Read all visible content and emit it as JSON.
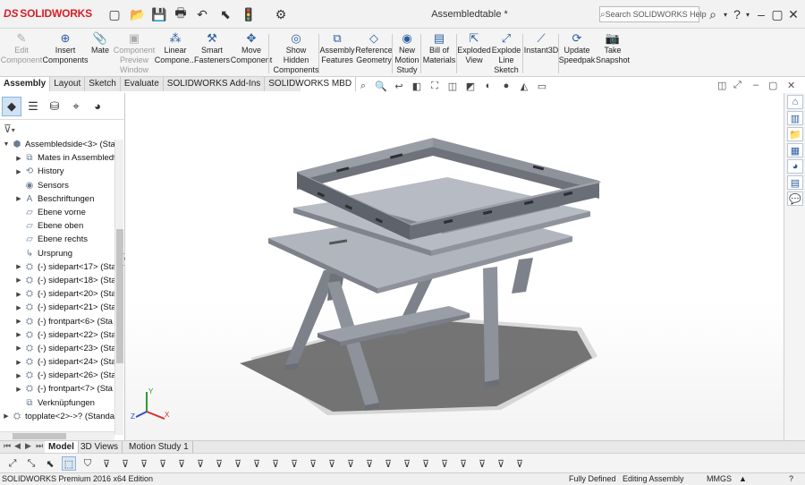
{
  "app": {
    "brand": "SOLIDWORKS",
    "brand_prefix": "DS",
    "document_title": "Assembledtable *"
  },
  "quick_access": [
    {
      "name": "new-document-icon",
      "glyph": "▢"
    },
    {
      "name": "open-document-icon",
      "glyph": "📂"
    },
    {
      "name": "save-icon",
      "glyph": "💾"
    },
    {
      "name": "print-icon",
      "glyph": "🖶"
    },
    {
      "name": "undo-icon",
      "glyph": "↶"
    },
    {
      "name": "select-cursor-icon",
      "glyph": "⬉"
    },
    {
      "name": "rebuild-icon",
      "glyph": "🚦"
    },
    {
      "name": "options-gear-icon",
      "glyph": "⚙"
    }
  ],
  "search": {
    "placeholder": "Search SOLIDWORKS Help",
    "icon": "search-icon"
  },
  "window_controls": {
    "help": "?",
    "minimize": "–",
    "restore": "▢",
    "close": "✕"
  },
  "command_manager": [
    {
      "id": "edit-component",
      "label": "Edit Component",
      "disabled": true,
      "icon": "edit-component-icon",
      "glyph": "✎"
    },
    {
      "id": "insert-components",
      "label": "Insert Components",
      "disabled": false,
      "icon": "insert-components-icon",
      "glyph": "⊕"
    },
    {
      "id": "mate",
      "label": "Mate",
      "disabled": false,
      "icon": "mate-paperclip-icon",
      "glyph": "📎"
    },
    {
      "id": "component-preview-window",
      "label": "Component Preview Window",
      "disabled": true,
      "icon": "component-preview-icon",
      "glyph": "▣"
    },
    {
      "id": "linear-component-pattern",
      "label": "Linear Compone...",
      "disabled": false,
      "icon": "linear-pattern-icon",
      "glyph": "⁂"
    },
    {
      "id": "smart-fasteners",
      "label": "Smart Fasteners",
      "disabled": false,
      "icon": "smart-fasteners-icon",
      "glyph": "⚒"
    },
    {
      "id": "move-component",
      "label": "Move Component",
      "disabled": false,
      "icon": "move-component-icon",
      "glyph": "✥"
    },
    {
      "id": "show-hidden-components",
      "label": "Show Hidden Components",
      "disabled": false,
      "icon": "show-hidden-icon",
      "glyph": "◎"
    },
    {
      "id": "assembly-features",
      "label": "Assembly Features",
      "disabled": false,
      "icon": "assembly-features-icon",
      "glyph": "⧉"
    },
    {
      "id": "reference-geometry",
      "label": "Reference Geometry",
      "disabled": false,
      "icon": "reference-geometry-icon",
      "glyph": "◇"
    },
    {
      "id": "new-motion-study",
      "label": "New Motion Study",
      "disabled": false,
      "icon": "motion-study-icon",
      "glyph": "◉"
    },
    {
      "id": "bill-of-materials",
      "label": "Bill of Materials",
      "disabled": false,
      "icon": "bill-of-materials-icon",
      "glyph": "▤"
    },
    {
      "id": "exploded-view",
      "label": "Exploded View",
      "disabled": false,
      "icon": "exploded-view-icon",
      "glyph": "⇱"
    },
    {
      "id": "explode-line-sketch",
      "label": "Explode Line Sketch",
      "disabled": false,
      "icon": "explode-line-sketch-icon",
      "glyph": "⤢"
    },
    {
      "id": "instant3d",
      "label": "Instant3D",
      "disabled": false,
      "icon": "instant3d-icon",
      "glyph": "⟋"
    },
    {
      "id": "update-speedpak",
      "label": "Update Speedpak",
      "disabled": false,
      "icon": "speedpak-icon",
      "glyph": "⟳"
    },
    {
      "id": "take-snapshot",
      "label": "Take Snapshot",
      "disabled": false,
      "icon": "camera-icon",
      "glyph": "📷"
    }
  ],
  "tabs": [
    {
      "label": "Assembly",
      "active": true
    },
    {
      "label": "Layout",
      "active": false
    },
    {
      "label": "Sketch",
      "active": false
    },
    {
      "label": "Evaluate",
      "active": false
    },
    {
      "label": "SOLIDWORKS Add-Ins",
      "active": false
    },
    {
      "label": "SOLIDWORKS MBD",
      "active": false
    }
  ],
  "heads_up": [
    {
      "name": "zoom-to-fit-icon",
      "glyph": "⌕"
    },
    {
      "name": "zoom-to-area-icon",
      "glyph": "🔍"
    },
    {
      "name": "previous-view-icon",
      "glyph": "↩"
    },
    {
      "name": "section-view-icon",
      "glyph": "◧"
    },
    {
      "name": "dynamic-annotation-icon",
      "glyph": "⛶"
    },
    {
      "name": "view-orientation-icon",
      "glyph": "◫"
    },
    {
      "name": "display-style-icon",
      "glyph": "◩"
    },
    {
      "name": "hide-show-items-icon",
      "glyph": "◐"
    },
    {
      "name": "edit-appearance-icon",
      "glyph": "●"
    },
    {
      "name": "apply-scene-icon",
      "glyph": "◭"
    },
    {
      "name": "view-settings-icon",
      "glyph": "▭"
    }
  ],
  "feature_manager": {
    "tabs": [
      {
        "name": "featuremanager-tab-icon",
        "glyph": "◆",
        "selected": true
      },
      {
        "name": "propertymanager-tab-icon",
        "glyph": "☰",
        "selected": false
      },
      {
        "name": "configurationmanager-tab-icon",
        "glyph": "⛁",
        "selected": false
      },
      {
        "name": "dimxpert-tab-icon",
        "glyph": "⌖",
        "selected": false
      },
      {
        "name": "display-manager-tab-icon",
        "glyph": "◕",
        "selected": false
      }
    ],
    "filter_icon": "filter-icon",
    "tree": [
      {
        "label": "Assembledside<3> (Stan",
        "arrow": "▼",
        "indent": 0,
        "icon": "assembly-icon",
        "glyph": "⬢"
      },
      {
        "label": "Mates in Assembledt",
        "arrow": "▶",
        "indent": 1,
        "icon": "mates-icon",
        "glyph": "⧉"
      },
      {
        "label": "History",
        "arrow": "▶",
        "indent": 1,
        "icon": "history-icon",
        "glyph": "⟲"
      },
      {
        "label": "Sensors",
        "arrow": "",
        "indent": 1,
        "icon": "sensors-icon",
        "glyph": "◉"
      },
      {
        "label": "Beschriftungen",
        "arrow": "▶",
        "indent": 1,
        "icon": "annotations-icon",
        "glyph": "A"
      },
      {
        "label": "Ebene vorne",
        "arrow": "",
        "indent": 1,
        "icon": "plane-icon",
        "glyph": "▱"
      },
      {
        "label": "Ebene oben",
        "arrow": "",
        "indent": 1,
        "icon": "plane-icon",
        "glyph": "▱"
      },
      {
        "label": "Ebene rechts",
        "arrow": "",
        "indent": 1,
        "icon": "plane-icon",
        "glyph": "▱"
      },
      {
        "label": "Ursprung",
        "arrow": "",
        "indent": 1,
        "icon": "origin-icon",
        "glyph": "↳"
      },
      {
        "label": "(-) sidepart<17> (Sta",
        "arrow": "▶",
        "indent": 1,
        "icon": "part-icon",
        "glyph": "⛭"
      },
      {
        "label": "(-) sidepart<18> (Sta",
        "arrow": "▶",
        "indent": 1,
        "icon": "part-icon",
        "glyph": "⛭"
      },
      {
        "label": "(-) sidepart<20> (Sta",
        "arrow": "▶",
        "indent": 1,
        "icon": "part-icon",
        "glyph": "⛭"
      },
      {
        "label": "(-) sidepart<21> (Sta",
        "arrow": "▶",
        "indent": 1,
        "icon": "part-icon",
        "glyph": "⛭"
      },
      {
        "label": "(-) frontpart<6> (Sta",
        "arrow": "▶",
        "indent": 1,
        "icon": "part-icon",
        "glyph": "⛭"
      },
      {
        "label": "(-) sidepart<22> (Sta",
        "arrow": "▶",
        "indent": 1,
        "icon": "part-icon",
        "glyph": "⛭"
      },
      {
        "label": "(-) sidepart<23> (Sta",
        "arrow": "▶",
        "indent": 1,
        "icon": "part-icon",
        "glyph": "⛭"
      },
      {
        "label": "(-) sidepart<24> (Sta",
        "arrow": "▶",
        "indent": 1,
        "icon": "part-icon",
        "glyph": "⛭"
      },
      {
        "label": "(-) sidepart<26> (Sta",
        "arrow": "▶",
        "indent": 1,
        "icon": "part-icon",
        "glyph": "⛭"
      },
      {
        "label": "(-) frontpart<7> (Sta",
        "arrow": "▶",
        "indent": 1,
        "icon": "part-icon",
        "glyph": "⛭"
      },
      {
        "label": "Verknüpfungen",
        "arrow": "",
        "indent": 1,
        "icon": "mates-icon",
        "glyph": "⧉"
      },
      {
        "label": "topplate<2>->? (Standar",
        "arrow": "▶",
        "indent": 0,
        "icon": "part-icon",
        "glyph": "⛭"
      }
    ]
  },
  "task_pane": [
    {
      "name": "solidworks-resources-icon",
      "glyph": "⌂"
    },
    {
      "name": "design-library-icon",
      "glyph": "▥"
    },
    {
      "name": "file-explorer-icon",
      "glyph": "📁"
    },
    {
      "name": "view-palette-icon",
      "glyph": "▦"
    },
    {
      "name": "appearances-icon",
      "glyph": "◕"
    },
    {
      "name": "custom-properties-icon",
      "glyph": "▤"
    },
    {
      "name": "forum-icon",
      "glyph": "💬"
    }
  ],
  "bottom_tabs": [
    {
      "label": "Model",
      "active": true
    },
    {
      "label": "3D Views",
      "active": false
    },
    {
      "label": "Motion Study 1",
      "active": false
    }
  ],
  "status": {
    "edition": "SOLIDWORKS Premium 2016 x64 Edition",
    "definition": "Fully Defined",
    "mode": "Editing Assembly",
    "units": "MMGS",
    "units_arrow": "▲",
    "help_icon": "?"
  },
  "colors": {
    "accent": "#2a5d9f",
    "brand": "#d61f26",
    "part": "#8e929b",
    "part_top": "#b3b7c0",
    "shadow": "#555555"
  }
}
